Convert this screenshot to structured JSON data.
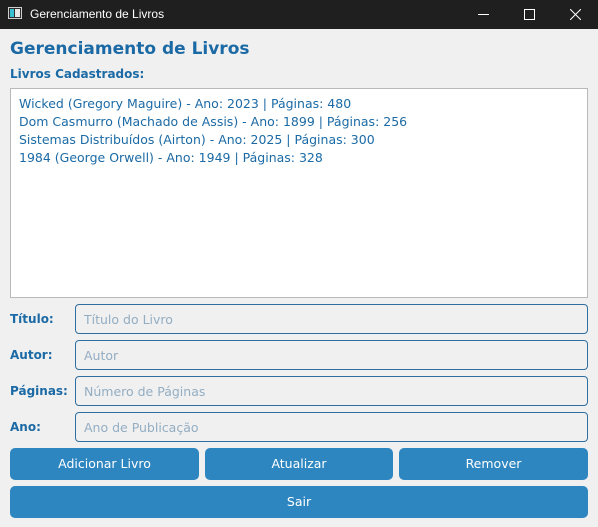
{
  "window": {
    "title": "Gerenciamento de Livros"
  },
  "main": {
    "heading": "Gerenciamento de Livros",
    "list_label": "Livros Cadastrados:",
    "books": [
      "Wicked (Gregory Maguire) - Ano: 2023 | Páginas: 480",
      "Dom Casmurro (Machado de Assis) - Ano: 1899 | Páginas: 256",
      "Sistemas Distribuídos (Airton) - Ano: 2025 | Páginas: 300",
      "1984 (George Orwell) - Ano: 1949 | Páginas: 328"
    ]
  },
  "form": {
    "titulo": {
      "label": "Título:",
      "placeholder": "Título do Livro",
      "value": ""
    },
    "autor": {
      "label": "Autor:",
      "placeholder": "Autor",
      "value": ""
    },
    "paginas": {
      "label": "Páginas:",
      "placeholder": "Número de Páginas",
      "value": ""
    },
    "ano": {
      "label": "Ano:",
      "placeholder": "Ano de Publicação",
      "value": ""
    }
  },
  "buttons": {
    "adicionar": "Adicionar Livro",
    "atualizar": "Atualizar",
    "remover": "Remover",
    "sair": "Sair"
  },
  "colors": {
    "accent": "#1b6aa5",
    "button": "#2e86c1",
    "titlebar": "#1f1f1f",
    "background": "#f0f0f0"
  },
  "icons": {
    "app": "app-window-icon",
    "minimize": "minimize-icon",
    "maximize": "maximize-icon",
    "close": "close-icon"
  }
}
